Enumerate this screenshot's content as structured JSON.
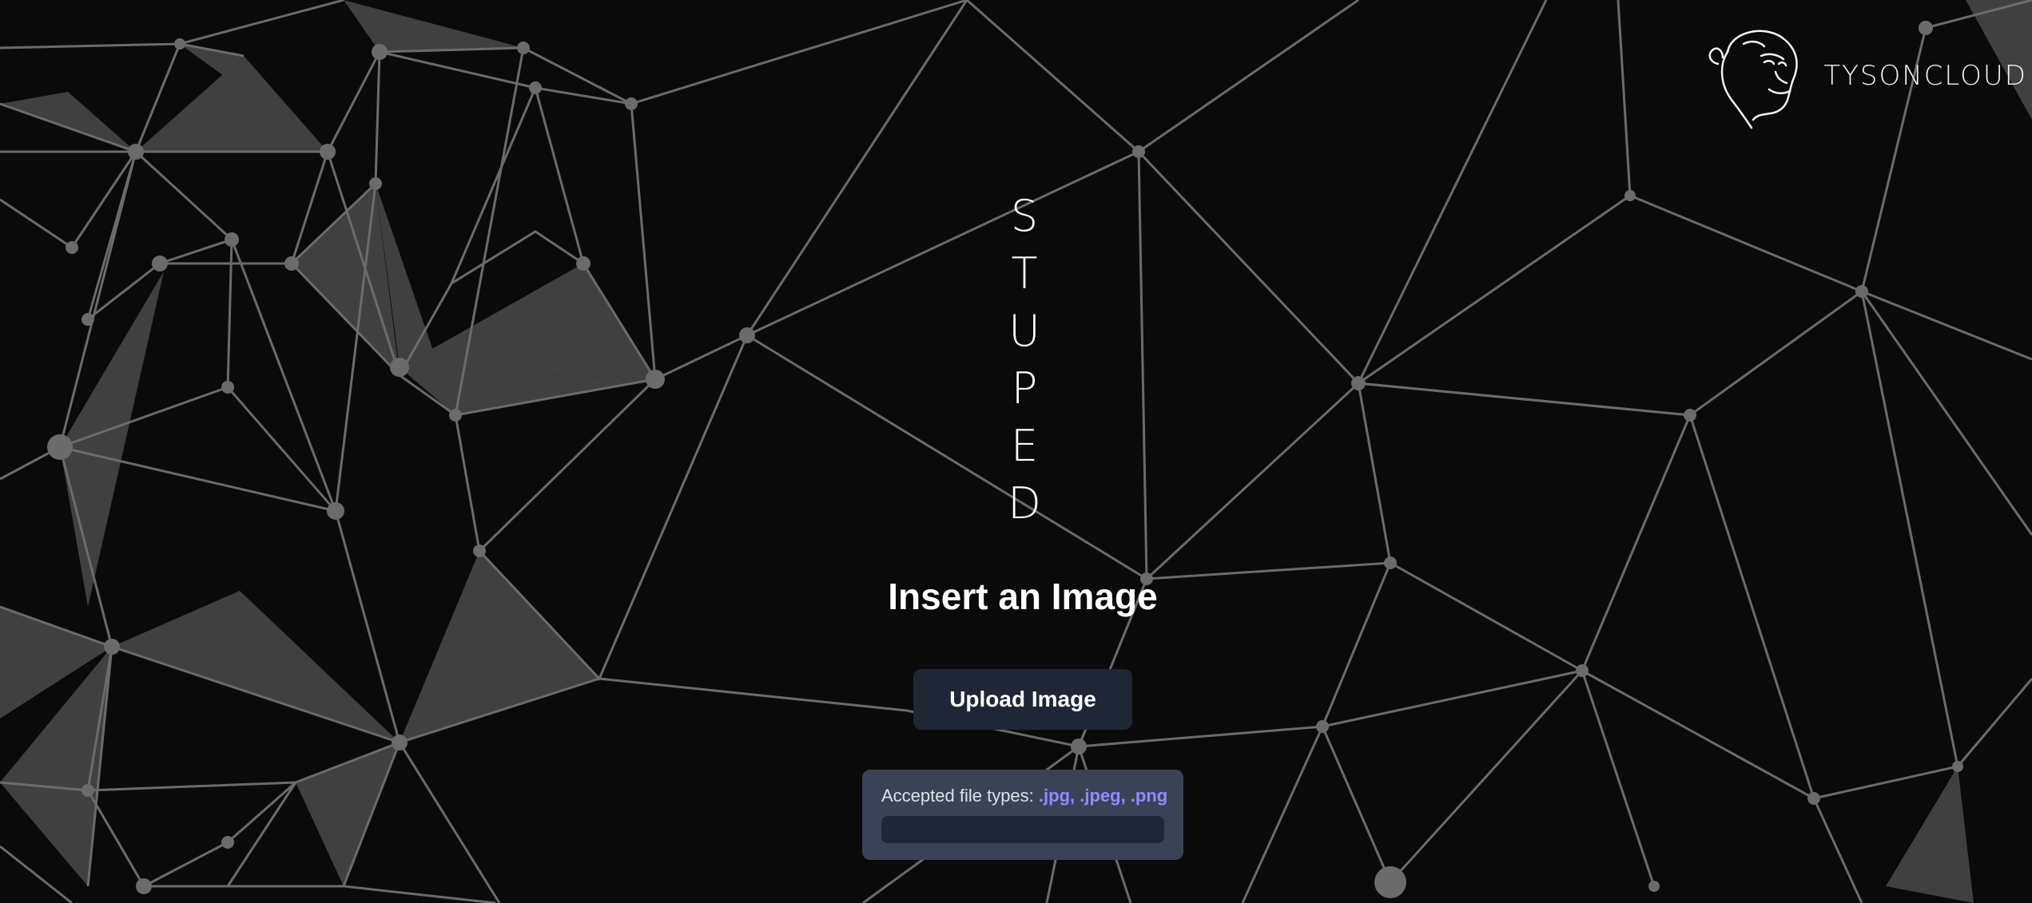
{
  "brand": {
    "name": "TYSONCLOUD",
    "logo_icon": "gorilla-head-icon"
  },
  "title_letters": [
    "S",
    "T",
    "U",
    "P",
    "E",
    "D"
  ],
  "heading": "Insert an Image",
  "upload_button": {
    "label": "Upload Image"
  },
  "accepted": {
    "label": "Accepted file types:",
    "types": ".jpg, .jpeg, .png"
  },
  "colors": {
    "background": "#0a0a0a",
    "mesh_line": "#6b6b6b",
    "button_bg": "#1f2737",
    "panel_bg": "#3a4356",
    "accent": "#8c8cff"
  }
}
